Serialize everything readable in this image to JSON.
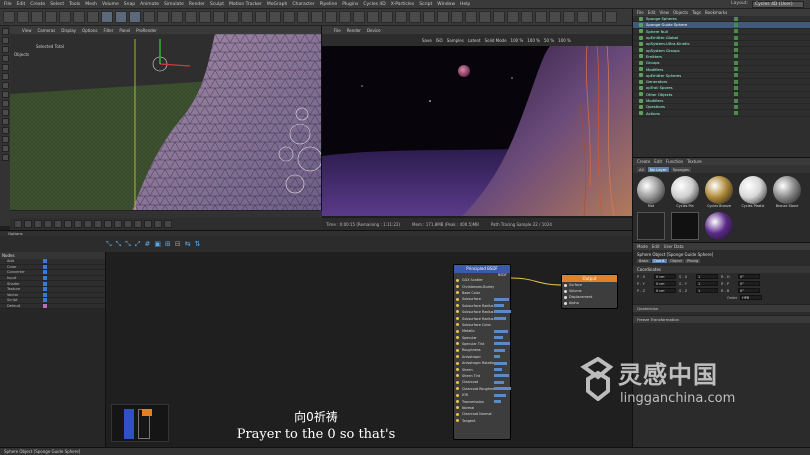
{
  "menubar": {
    "items": [
      "File",
      "Edit",
      "Create",
      "Select",
      "Tools",
      "Mesh",
      "Volume",
      "Snap",
      "Animate",
      "Simulate",
      "Render",
      "Sculpt",
      "Motion Tracker",
      "MoGraph",
      "Character",
      "Pipeline",
      "Plugins",
      "Cycles 4D",
      "X-Particles",
      "Script",
      "Window",
      "Help"
    ],
    "layout_label": "Layout:",
    "layout_value": "Cycles 4D (User)"
  },
  "viewport1": {
    "menu": [
      "View",
      "Cameras",
      "Display",
      "Options",
      "Filter",
      "Panel",
      "ProRender"
    ],
    "label": "Selected Total",
    "label2": "Objects"
  },
  "viewport2": {
    "menu": [
      "File",
      "Render",
      "Device"
    ],
    "stats": [
      "Save",
      "ISO",
      "Samples",
      "Latent",
      "Solid Mode",
      "100 %",
      "100 %",
      "50 %",
      "100 %"
    ]
  },
  "render_status": [
    "Time : 0:00:15 (Remaining : 1:11:22)",
    "Mem : 171.8MB (Peak : 400.5)MB",
    "Path Tracing Sample 22 / 1024"
  ],
  "object_manager": {
    "menu": [
      "File",
      "Edit",
      "View",
      "Objects",
      "Tags",
      "Bookmarks"
    ],
    "items": [
      {
        "label": "Sponge Spheres",
        "selected": false
      },
      {
        "label": "Sponge Guide Sphere",
        "selected": true
      },
      {
        "label": "Sphere Null",
        "selected": false
      },
      {
        "label": "xpEmitter-Global",
        "selected": false
      },
      {
        "label": "xpSystem-Ultra-Kinetic",
        "selected": false
      },
      {
        "label": "xpSystem Groups",
        "selected": false
      },
      {
        "label": "Emitters",
        "selected": false
      },
      {
        "label": "Groups",
        "selected": false
      },
      {
        "label": "Modifiers",
        "selected": false
      },
      {
        "label": "xpEmitter Spheres",
        "selected": false
      },
      {
        "label": "Generators",
        "selected": false
      },
      {
        "label": "xpTrail Spores",
        "selected": false
      },
      {
        "label": "Other Objects",
        "selected": false
      },
      {
        "label": "Modifiers",
        "selected": false
      },
      {
        "label": "Questions",
        "selected": false
      },
      {
        "label": "Actions",
        "selected": false
      }
    ]
  },
  "material_manager": {
    "menu": [
      "Create",
      "Edit",
      "Function",
      "Texture"
    ],
    "tabs": [
      {
        "label": "All",
        "active": false
      },
      {
        "label": "No Layer",
        "active": true
      },
      {
        "label": "Sponges",
        "active": false
      }
    ],
    "materials": [
      {
        "label": "Mat",
        "color": "#9a9a9a"
      },
      {
        "label": "Cycles Pla",
        "color": "#cfcfcf"
      },
      {
        "label": "Cycles Bronze",
        "color": "#b08a3a"
      },
      {
        "label": "Cycles Plastic",
        "color": "#d8d8d8"
      },
      {
        "label": "Bronze Stone",
        "color": "#8a8a8a"
      },
      {
        "label": "",
        "color": "#222222"
      },
      {
        "label": "",
        "color": "#111111"
      },
      {
        "label": "",
        "color": "#5a2a8a"
      }
    ]
  },
  "attribute_manager": {
    "menu": [
      "Mode",
      "Edit",
      "User Data"
    ],
    "title": "Sphere Object [Sponge Guide Sphere]",
    "tabs": [
      {
        "label": "Basic",
        "active": false
      },
      {
        "label": "Coord.",
        "active": true
      },
      {
        "label": "Object",
        "active": false
      },
      {
        "label": "Phong",
        "active": false
      }
    ],
    "section": "Coordinates",
    "rows": [
      {
        "k": "P . X",
        "v": "0 cm",
        "k2": "S . X",
        "v2": "1",
        "k3": "R . H",
        "v3": "0°"
      },
      {
        "k": "P . Y",
        "v": "0 cm",
        "k2": "S . Y",
        "v2": "1",
        "k3": "R . P",
        "v3": "0°"
      },
      {
        "k": "P . Z",
        "v": "0 cm",
        "k2": "S . Z",
        "v2": "1",
        "k3": "R . B",
        "v3": "0°"
      }
    ],
    "order_label": "Order",
    "order_value": "HPB",
    "collapsed": [
      "Quaternion",
      "Freeze Transformation"
    ]
  },
  "node_editor": {
    "header": "Options",
    "nodes_title": "Nodes",
    "node_list": [
      {
        "label": "Add",
        "color": "#3a7ad0"
      },
      {
        "label": "Color",
        "color": "#3a7ad0"
      },
      {
        "label": "Converter",
        "color": "#3a7ad0"
      },
      {
        "label": "Input",
        "color": "#3a7ad0"
      },
      {
        "label": "Shader",
        "color": "#3a7ad0"
      },
      {
        "label": "Texture",
        "color": "#3a7ad0"
      },
      {
        "label": "Vector",
        "color": "#3a7ad0"
      },
      {
        "label": "Script",
        "color": "#3a7ad0"
      },
      {
        "label": "Default",
        "color": "#c06ac0"
      }
    ],
    "principled": {
      "title": "Principled BSDF",
      "out": "BSDF",
      "ports": [
        "GGX Scatter",
        "Christensen-Burley",
        "Base Color",
        "Subsurface",
        "Subsurface Radius",
        "Subsurface Radius",
        "Subsurface Radius",
        "Subsurface Color",
        "Metallic",
        "Specular",
        "Specular Tint",
        "Roughness",
        "Anisotropic",
        "Anisotropic Rotation",
        "Sheen",
        "Sheen Tint",
        "Clearcoat",
        "Clearcoat Roughness",
        "IOR",
        "Transmission",
        "Normal",
        "Clearcoat Normal",
        "Tangent"
      ]
    },
    "output": {
      "title": "Output",
      "ports": [
        "Surface",
        "Volume",
        "Displacement",
        "Alpha"
      ]
    }
  },
  "subtitle": {
    "cn": "向0祈祷",
    "en": "Prayer to the 0 so that's"
  },
  "watermark": {
    "cn": "灵感中国",
    "en": "lingganchina.com"
  },
  "statusbar": "Sphere Object [Sponge Guide Sphere]"
}
